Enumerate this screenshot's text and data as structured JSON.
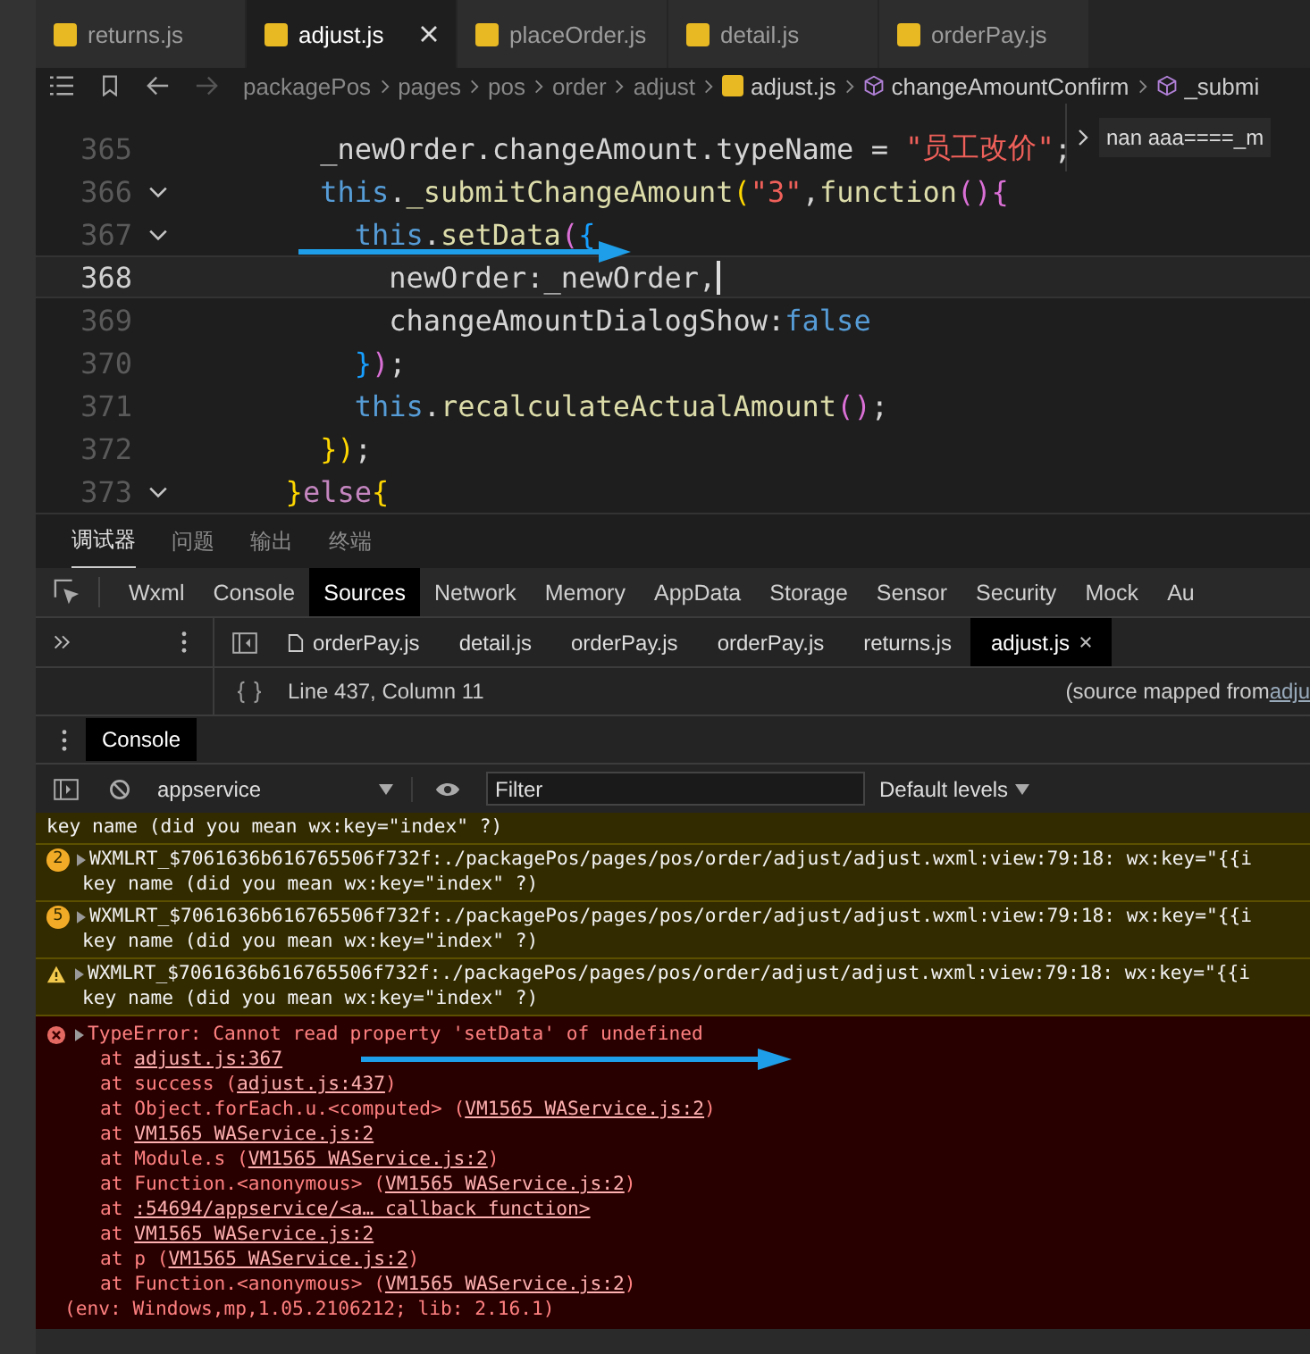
{
  "editor_tabs": [
    {
      "label": "returns.js",
      "selected": false
    },
    {
      "label": "adjust.js",
      "selected": true
    },
    {
      "label": "placeOrder.js",
      "selected": false
    },
    {
      "label": "detail.js",
      "selected": false
    },
    {
      "label": "orderPay.js",
      "selected": false
    }
  ],
  "breadcrumb": [
    {
      "label": "packagePos",
      "kind": "folder"
    },
    {
      "label": "pages",
      "kind": "folder"
    },
    {
      "label": "pos",
      "kind": "folder"
    },
    {
      "label": "order",
      "kind": "folder"
    },
    {
      "label": "adjust",
      "kind": "folder"
    },
    {
      "label": "adjust.js",
      "kind": "file"
    },
    {
      "label": "changeAmountConfirm",
      "kind": "method"
    },
    {
      "label": "_submi",
      "kind": "method"
    }
  ],
  "code_lines": [
    {
      "number": "365",
      "active": false,
      "foldable": false,
      "tokens": [
        {
          "text": "        _newOrder.changeAmount.typeName = ",
          "kind": "plain"
        },
        {
          "text": "\"员工改价\"",
          "kind": "string"
        },
        {
          "text": ";",
          "kind": "plain"
        }
      ]
    },
    {
      "number": "366",
      "active": false,
      "foldable": true,
      "tokens": [
        {
          "text": "        this",
          "kind": "keyword"
        },
        {
          "text": ".",
          "kind": "plain"
        },
        {
          "text": "_submitChangeAmount",
          "kind": "func"
        },
        {
          "text": "(",
          "kind": "bracket1"
        },
        {
          "text": "\"3\"",
          "kind": "string"
        },
        {
          "text": ",",
          "kind": "plain"
        },
        {
          "text": "function",
          "kind": "func"
        },
        {
          "text": "(){",
          "kind": "bracket2"
        }
      ]
    },
    {
      "number": "367",
      "active": false,
      "foldable": true,
      "tokens": [
        {
          "text": "          this",
          "kind": "keyword"
        },
        {
          "text": ".",
          "kind": "plain"
        },
        {
          "text": "setData",
          "kind": "func"
        },
        {
          "text": "(",
          "kind": "bracket2"
        },
        {
          "text": "{",
          "kind": "bracket3"
        }
      ]
    },
    {
      "number": "368",
      "active": true,
      "foldable": false,
      "tokens": [
        {
          "text": "            newOrder",
          "kind": "prop"
        },
        {
          "text": ":",
          "kind": "plain"
        },
        {
          "text": "_newOrder",
          "kind": "prop"
        },
        {
          "text": ",",
          "kind": "plain"
        }
      ]
    },
    {
      "number": "369",
      "active": false,
      "foldable": false,
      "tokens": [
        {
          "text": "            changeAmountDialogShow",
          "kind": "prop"
        },
        {
          "text": ":",
          "kind": "plain"
        },
        {
          "text": "false",
          "kind": "keyword"
        }
      ]
    },
    {
      "number": "370",
      "active": false,
      "foldable": false,
      "tokens": [
        {
          "text": "          }",
          "kind": "bracket3"
        },
        {
          "text": ")",
          "kind": "bracket2"
        },
        {
          "text": ";",
          "kind": "plain"
        }
      ]
    },
    {
      "number": "371",
      "active": false,
      "foldable": false,
      "tokens": [
        {
          "text": "          this",
          "kind": "keyword"
        },
        {
          "text": ".",
          "kind": "plain"
        },
        {
          "text": "recalculateActualAmount",
          "kind": "func"
        },
        {
          "text": "()",
          "kind": "bracket2"
        },
        {
          "text": ";",
          "kind": "plain"
        }
      ]
    },
    {
      "number": "372",
      "active": false,
      "foldable": false,
      "tokens": [
        {
          "text": "        })",
          "kind": "bracket1"
        },
        {
          "text": ";",
          "kind": "plain"
        }
      ]
    },
    {
      "number": "373",
      "active": false,
      "foldable": true,
      "tokens": [
        {
          "text": "      }",
          "kind": "bracket1"
        },
        {
          "text": "else",
          "kind": "keyword2"
        },
        {
          "text": "{",
          "kind": "bracket1"
        }
      ]
    }
  ],
  "hover_tooltip": "nan aaa====_m",
  "panel_tabs": [
    {
      "label": "调试器",
      "selected": true
    },
    {
      "label": "问题",
      "selected": false
    },
    {
      "label": "输出",
      "selected": false
    },
    {
      "label": "终端",
      "selected": false
    }
  ],
  "devtools_tabs": [
    {
      "label": "Wxml",
      "selected": false
    },
    {
      "label": "Console",
      "selected": false
    },
    {
      "label": "Sources",
      "selected": true
    },
    {
      "label": "Network",
      "selected": false
    },
    {
      "label": "Memory",
      "selected": false
    },
    {
      "label": "AppData",
      "selected": false
    },
    {
      "label": "Storage",
      "selected": false
    },
    {
      "label": "Sensor",
      "selected": false
    },
    {
      "label": "Security",
      "selected": false
    },
    {
      "label": "Mock",
      "selected": false
    },
    {
      "label": "Au",
      "selected": false
    }
  ],
  "source_tabs": [
    {
      "label": "orderPay.js",
      "selected": false
    },
    {
      "label": "detail.js",
      "selected": false
    },
    {
      "label": "orderPay.js",
      "selected": false
    },
    {
      "label": "orderPay.js",
      "selected": false
    },
    {
      "label": "returns.js",
      "selected": false
    },
    {
      "label": "adjust.js",
      "selected": true
    }
  ],
  "status": {
    "position": "Line 437, Column 11",
    "source_note": "(source mapped from ",
    "source_link": "adju"
  },
  "console_tab": {
    "label": "Console",
    "selected": true
  },
  "console_toolbar": {
    "context": "appservice",
    "filter_placeholder": "Filter",
    "levels": "Default levels"
  },
  "messages": [
    {
      "kind": "warning",
      "lines": [
        "key name (did you mean wx:key=\"index\" ?)"
      ]
    },
    {
      "kind": "warning",
      "count": "2",
      "text": "WXMLRT_$7061636b616765506f732f:./packagePos/pages/pos/order/adjust/adjust.wxml:view:79:18: wx:key=\"{{i",
      "lines": [
        "key name (did you mean wx:key=\"index\" ?)"
      ]
    },
    {
      "kind": "warning",
      "count": "5",
      "text": "WXMLRT_$7061636b616765506f732f:./packagePos/pages/pos/order/adjust/adjust.wxml:view:79:18: wx:key=\"{{i",
      "lines": [
        "key name (did you mean wx:key=\"index\" ?)"
      ]
    },
    {
      "kind": "warning",
      "text": "WXMLRT_$7061636b616765506f732f:./packagePos/pages/pos/order/adjust/adjust.wxml:view:79:18: wx:key=\"{{i",
      "lines": [
        "key name (did you mean wx:key=\"index\" ?)"
      ]
    },
    {
      "kind": "error",
      "text": "TypeError: Cannot read property 'setData' of undefined",
      "stack": [
        {
          "pre": "at ",
          "link": "adjust.js:367"
        },
        {
          "pre": "at success (",
          "link": "adjust.js:437",
          "post": ")"
        },
        {
          "pre": "at Object.forEach.u.<computed> (",
          "link": "VM1565 WAService.js:2",
          "post": ")"
        },
        {
          "pre": "at ",
          "link": "VM1565 WAService.js:2"
        },
        {
          "pre": "at Module.s (",
          "link": "VM1565 WAService.js:2",
          "post": ")"
        },
        {
          "pre": "at Function.<anonymous> (",
          "link": "VM1565 WAService.js:2",
          "post": ")"
        },
        {
          "pre": "at ",
          "link": ":54694/appservice/<a… callback function>"
        },
        {
          "pre": "at ",
          "link": "VM1565 WAService.js:2"
        },
        {
          "pre": "at p (",
          "link": "VM1565 WAService.js:2",
          "post": ")"
        },
        {
          "pre": "at Function.<anonymous> (",
          "link": "VM1565 WAService.js:2",
          "post": ")"
        }
      ],
      "lines": [
        "(env: Windows,mp,1.05.2106212; lib: 2.16.1)"
      ]
    }
  ]
}
